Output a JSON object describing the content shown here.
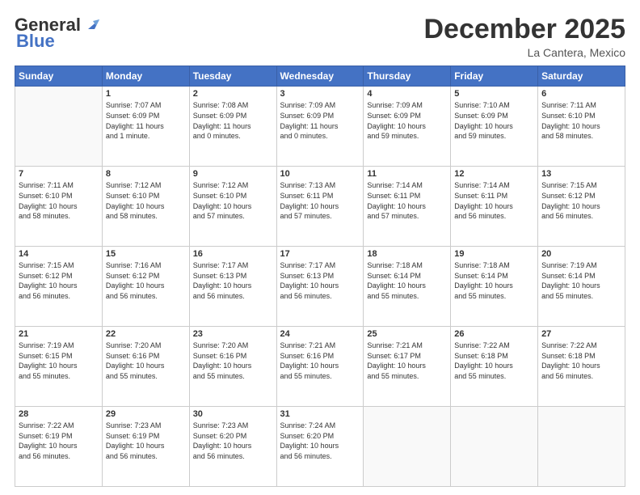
{
  "logo": {
    "line1": "General",
    "line2": "Blue"
  },
  "title": "December 2025",
  "location": "La Cantera, Mexico",
  "days_header": [
    "Sunday",
    "Monday",
    "Tuesday",
    "Wednesday",
    "Thursday",
    "Friday",
    "Saturday"
  ],
  "weeks": [
    [
      {
        "day": "",
        "info": ""
      },
      {
        "day": "1",
        "info": "Sunrise: 7:07 AM\nSunset: 6:09 PM\nDaylight: 11 hours\nand 1 minute."
      },
      {
        "day": "2",
        "info": "Sunrise: 7:08 AM\nSunset: 6:09 PM\nDaylight: 11 hours\nand 0 minutes."
      },
      {
        "day": "3",
        "info": "Sunrise: 7:09 AM\nSunset: 6:09 PM\nDaylight: 11 hours\nand 0 minutes."
      },
      {
        "day": "4",
        "info": "Sunrise: 7:09 AM\nSunset: 6:09 PM\nDaylight: 10 hours\nand 59 minutes."
      },
      {
        "day": "5",
        "info": "Sunrise: 7:10 AM\nSunset: 6:09 PM\nDaylight: 10 hours\nand 59 minutes."
      },
      {
        "day": "6",
        "info": "Sunrise: 7:11 AM\nSunset: 6:10 PM\nDaylight: 10 hours\nand 58 minutes."
      }
    ],
    [
      {
        "day": "7",
        "info": "Sunrise: 7:11 AM\nSunset: 6:10 PM\nDaylight: 10 hours\nand 58 minutes."
      },
      {
        "day": "8",
        "info": "Sunrise: 7:12 AM\nSunset: 6:10 PM\nDaylight: 10 hours\nand 58 minutes."
      },
      {
        "day": "9",
        "info": "Sunrise: 7:12 AM\nSunset: 6:10 PM\nDaylight: 10 hours\nand 57 minutes."
      },
      {
        "day": "10",
        "info": "Sunrise: 7:13 AM\nSunset: 6:11 PM\nDaylight: 10 hours\nand 57 minutes."
      },
      {
        "day": "11",
        "info": "Sunrise: 7:14 AM\nSunset: 6:11 PM\nDaylight: 10 hours\nand 57 minutes."
      },
      {
        "day": "12",
        "info": "Sunrise: 7:14 AM\nSunset: 6:11 PM\nDaylight: 10 hours\nand 56 minutes."
      },
      {
        "day": "13",
        "info": "Sunrise: 7:15 AM\nSunset: 6:12 PM\nDaylight: 10 hours\nand 56 minutes."
      }
    ],
    [
      {
        "day": "14",
        "info": "Sunrise: 7:15 AM\nSunset: 6:12 PM\nDaylight: 10 hours\nand 56 minutes."
      },
      {
        "day": "15",
        "info": "Sunrise: 7:16 AM\nSunset: 6:12 PM\nDaylight: 10 hours\nand 56 minutes."
      },
      {
        "day": "16",
        "info": "Sunrise: 7:17 AM\nSunset: 6:13 PM\nDaylight: 10 hours\nand 56 minutes."
      },
      {
        "day": "17",
        "info": "Sunrise: 7:17 AM\nSunset: 6:13 PM\nDaylight: 10 hours\nand 56 minutes."
      },
      {
        "day": "18",
        "info": "Sunrise: 7:18 AM\nSunset: 6:14 PM\nDaylight: 10 hours\nand 55 minutes."
      },
      {
        "day": "19",
        "info": "Sunrise: 7:18 AM\nSunset: 6:14 PM\nDaylight: 10 hours\nand 55 minutes."
      },
      {
        "day": "20",
        "info": "Sunrise: 7:19 AM\nSunset: 6:14 PM\nDaylight: 10 hours\nand 55 minutes."
      }
    ],
    [
      {
        "day": "21",
        "info": "Sunrise: 7:19 AM\nSunset: 6:15 PM\nDaylight: 10 hours\nand 55 minutes."
      },
      {
        "day": "22",
        "info": "Sunrise: 7:20 AM\nSunset: 6:16 PM\nDaylight: 10 hours\nand 55 minutes."
      },
      {
        "day": "23",
        "info": "Sunrise: 7:20 AM\nSunset: 6:16 PM\nDaylight: 10 hours\nand 55 minutes."
      },
      {
        "day": "24",
        "info": "Sunrise: 7:21 AM\nSunset: 6:16 PM\nDaylight: 10 hours\nand 55 minutes."
      },
      {
        "day": "25",
        "info": "Sunrise: 7:21 AM\nSunset: 6:17 PM\nDaylight: 10 hours\nand 55 minutes."
      },
      {
        "day": "26",
        "info": "Sunrise: 7:22 AM\nSunset: 6:18 PM\nDaylight: 10 hours\nand 55 minutes."
      },
      {
        "day": "27",
        "info": "Sunrise: 7:22 AM\nSunset: 6:18 PM\nDaylight: 10 hours\nand 56 minutes."
      }
    ],
    [
      {
        "day": "28",
        "info": "Sunrise: 7:22 AM\nSunset: 6:19 PM\nDaylight: 10 hours\nand 56 minutes."
      },
      {
        "day": "29",
        "info": "Sunrise: 7:23 AM\nSunset: 6:19 PM\nDaylight: 10 hours\nand 56 minutes."
      },
      {
        "day": "30",
        "info": "Sunrise: 7:23 AM\nSunset: 6:20 PM\nDaylight: 10 hours\nand 56 minutes."
      },
      {
        "day": "31",
        "info": "Sunrise: 7:24 AM\nSunset: 6:20 PM\nDaylight: 10 hours\nand 56 minutes."
      },
      {
        "day": "",
        "info": ""
      },
      {
        "day": "",
        "info": ""
      },
      {
        "day": "",
        "info": ""
      }
    ]
  ]
}
